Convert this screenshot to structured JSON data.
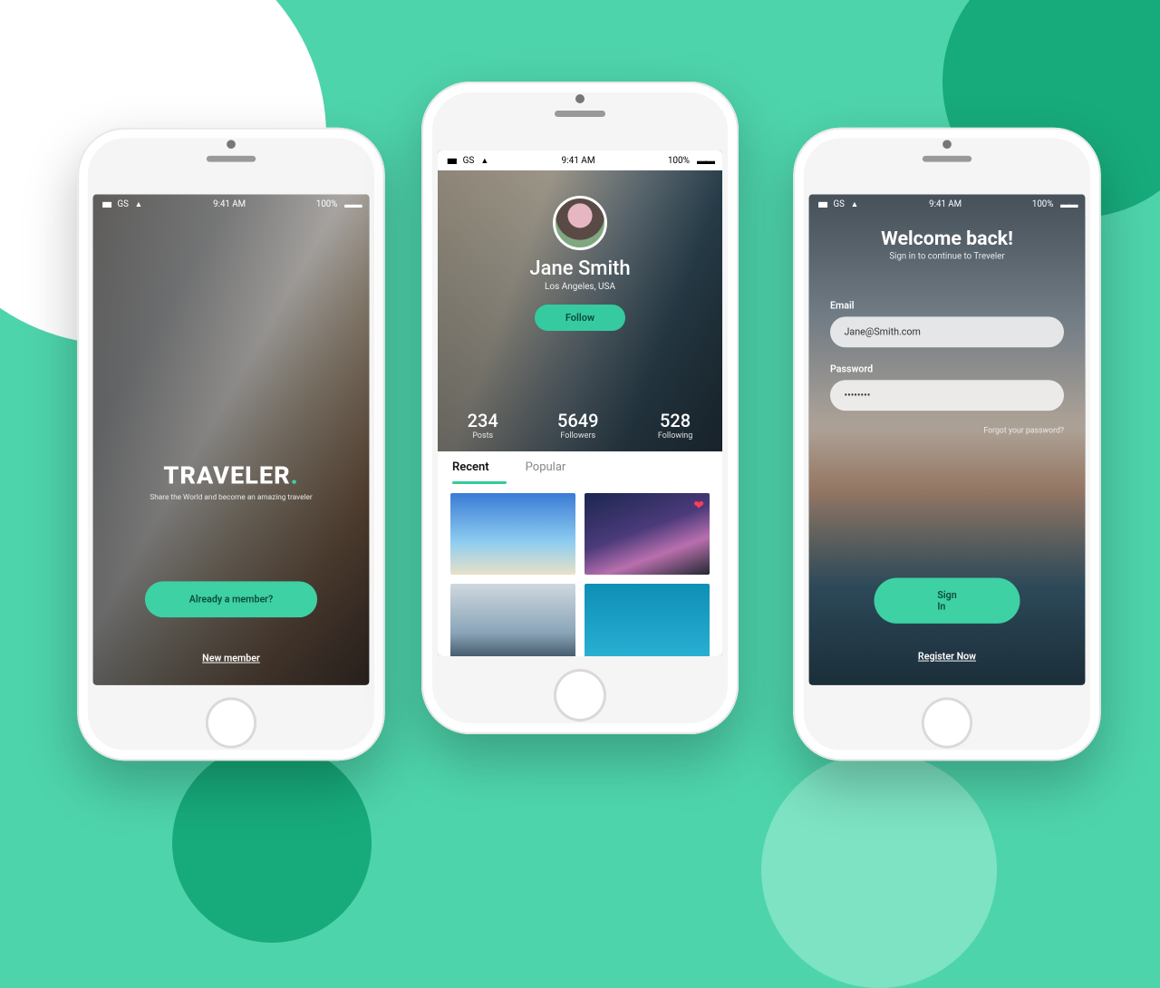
{
  "status": {
    "carrier": "GS",
    "time": "9:41 AM",
    "battery": "100%"
  },
  "colors": {
    "accent": "#3dd1a4"
  },
  "onboarding": {
    "brand": "TRAVELER",
    "brand_dot": ".",
    "tagline": "Share the World and become an amazing traveler",
    "cta_member": "Already a member?",
    "cta_new": "New member"
  },
  "profile": {
    "name": "Jane Smith",
    "location": "Los Angeles, USA",
    "follow_label": "Follow",
    "stats": [
      {
        "value": "234",
        "label": "Posts"
      },
      {
        "value": "5649",
        "label": "Followers"
      },
      {
        "value": "528",
        "label": "Following"
      }
    ],
    "tabs": {
      "recent": "Recent",
      "popular": "Popular",
      "active": "recent"
    },
    "like_icon": "heart-icon"
  },
  "login": {
    "title": "Welcome back!",
    "subtitle": "Sign in to continue to Treveler",
    "email_label": "Email",
    "email_value": "Jane@Smith.com",
    "password_label": "Password",
    "password_value": "••••••••",
    "forgot": "Forgot your password?",
    "signin": "Sign In",
    "register": "Register Now"
  }
}
